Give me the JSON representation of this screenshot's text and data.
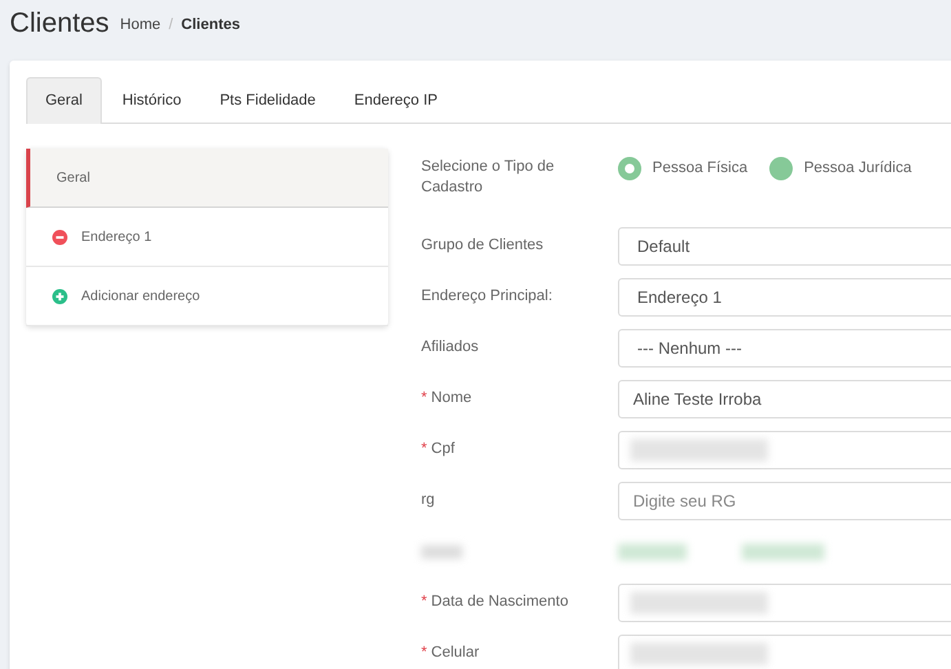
{
  "page_title": "Clientes",
  "breadcrumb_separator": "/",
  "required_mark": "*",
  "breadcrumb": [
    {
      "label": "Home",
      "current": false
    },
    {
      "label": "Clientes",
      "current": true
    }
  ],
  "tabs": [
    {
      "label": "Geral",
      "selected": true
    },
    {
      "label": "Histórico",
      "selected": false
    },
    {
      "label": "Pts Fidelidade",
      "selected": false
    },
    {
      "label": "Endereço IP",
      "selected": false
    }
  ],
  "sidebar": {
    "items": [
      {
        "kind": "section",
        "label": "Geral",
        "selected": true
      },
      {
        "kind": "remove",
        "label": "Endereço 1",
        "selected": false
      },
      {
        "kind": "add",
        "label": "Adicionar endereço",
        "selected": false
      }
    ]
  },
  "form": {
    "rows": [
      {
        "kind": "radio",
        "label": "Selecione o Tipo de Cadastro",
        "required": false,
        "options": [
          {
            "label": "Pessoa Física",
            "selected": true
          },
          {
            "label": "Pessoa Jurídica",
            "selected": false
          }
        ]
      },
      {
        "kind": "select",
        "label": "Grupo de Clientes",
        "required": false,
        "value": "Default"
      },
      {
        "kind": "select",
        "label": "Endereço Principal:",
        "required": false,
        "value": "Endereço 1"
      },
      {
        "kind": "select",
        "label": "Afiliados",
        "required": false,
        "value": "--- Nenhum ---"
      },
      {
        "kind": "input",
        "label": "Nome",
        "required": true,
        "value": "Aline Teste Irroba"
      },
      {
        "kind": "input",
        "label": "Cpf",
        "required": true,
        "redacted": true
      },
      {
        "kind": "input",
        "label": "rg",
        "required": false,
        "placeholder": "Digite seu RG"
      },
      {
        "kind": "blurred"
      },
      {
        "kind": "input",
        "label": "Data de Nascimento",
        "required": true,
        "redacted": true
      },
      {
        "kind": "input",
        "label": "Celular",
        "required": true,
        "redacted": true
      }
    ]
  }
}
